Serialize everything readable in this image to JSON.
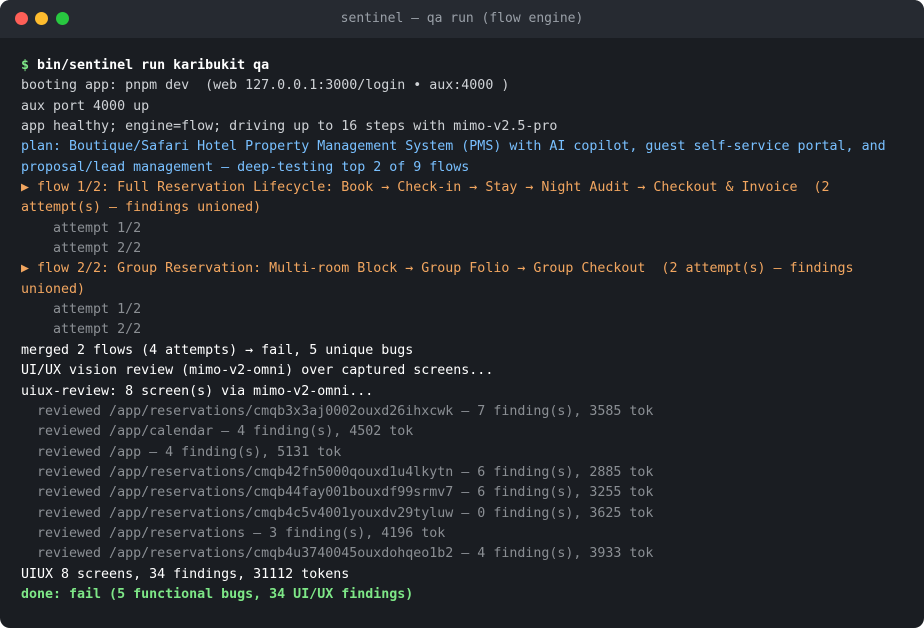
{
  "window": {
    "title": "sentinel — qa run (flow engine)"
  },
  "terminal": {
    "prompt_symbol": "$",
    "command": "bin/sentinel run karibukit qa",
    "lines": {
      "boot": "booting app: pnpm dev  (web 127.0.0.1:3000/login • aux:4000 )",
      "aux": "aux port 4000 up",
      "healthy": "app healthy; engine=flow; driving up to 16 steps with mimo-v2.5-pro",
      "plan": "plan: Boutique/Safari Hotel Property Management System (PMS) with AI copilot, guest self-service portal, and proposal/lead management — deep-testing top 2 of 9 flows",
      "flow1": "▶ flow 1/2: Full Reservation Lifecycle: Book → Check-in → Stay → Night Audit → Checkout & Invoice  (2 attempt(s) — findings unioned)",
      "flow1_attempt1": "    attempt 1/2",
      "flow1_attempt2": "    attempt 2/2",
      "flow2": "▶ flow 2/2: Group Reservation: Multi-room Block → Group Folio → Group Checkout  (2 attempt(s) — findings unioned)",
      "flow2_attempt1": "    attempt 1/2",
      "flow2_attempt2": "    attempt 2/2",
      "merged": "merged 2 flows (4 attempts) → fail, 5 unique bugs",
      "vision": "UI/UX vision review (mimo-v2-omni) over captured screens...",
      "uiux_review": "uiux-review: 8 screen(s) via mimo-v2-omni...",
      "reviewed": [
        "  reviewed /app/reservations/cmqb3x3aj0002ouxd26ihxcwk — 7 finding(s), 3585 tok",
        "  reviewed /app/calendar — 4 finding(s), 4502 tok",
        "  reviewed /app — 4 finding(s), 5131 tok",
        "  reviewed /app/reservations/cmqb42fn5000qouxd1u4lkytn — 6 finding(s), 2885 tok",
        "  reviewed /app/reservations/cmqb44fay001bouxdf99srmv7 — 6 finding(s), 3255 tok",
        "  reviewed /app/reservations/cmqb4c5v4001youxdv29tyluw — 0 finding(s), 3625 tok",
        "  reviewed /app/reservations — 3 finding(s), 4196 tok",
        "  reviewed /app/reservations/cmqb4u3740045ouxdohqeo1b2 — 4 finding(s), 3933 tok"
      ],
      "uiux_summary": "UIUX 8 screens, 34 findings, 31112 tokens",
      "done": "done: fail (5 functional bugs, 34 UI/UX findings)"
    }
  }
}
